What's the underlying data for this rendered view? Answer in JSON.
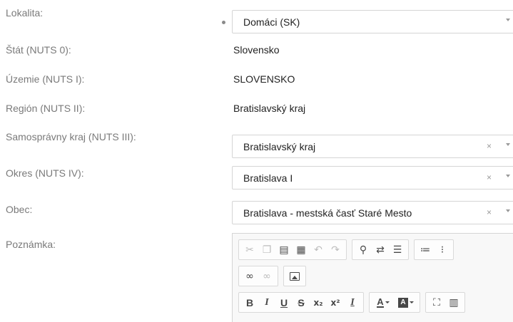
{
  "form": {
    "lokalita": {
      "label": "Lokalita:",
      "value": "Domáci (SK)"
    },
    "stat": {
      "label": "Štát (NUTS 0):",
      "value": "Slovensko"
    },
    "uzemie": {
      "label": "Územie (NUTS I):",
      "value": "SLOVENSKO"
    },
    "region": {
      "label": "Región (NUTS II):",
      "value": "Bratislavský kraj"
    },
    "kraj": {
      "label": "Samosprávny kraj (NUTS III):",
      "value": "Bratislavský kraj"
    },
    "okres": {
      "label": "Okres (NUTS IV):",
      "value": "Bratislava I"
    },
    "obec": {
      "label": "Obec:",
      "value": "Bratislava - mestská časť Staré Mesto"
    },
    "poznamka": {
      "label": "Poznámka:"
    }
  },
  "select_clear_glyph": "×",
  "editor": {
    "bold": "B",
    "italic": "I",
    "underline": "U",
    "strike": "S",
    "subscript": "x₂",
    "superscript": "x²",
    "remove_format": "I",
    "text_color": "A",
    "bg_color": "A",
    "icons": [
      "cut-icon",
      "copy-icon",
      "paste-icon",
      "paste-text-icon",
      "undo-icon",
      "redo-icon",
      "find-icon",
      "replace-icon",
      "select-all-icon",
      "numbered-list-icon",
      "bulleted-list-icon",
      "link-icon",
      "unlink-icon",
      "image-icon",
      "maximize-icon",
      "show-blocks-icon"
    ]
  },
  "colors": {
    "label": "#7a7a7a",
    "value": "#222222",
    "border": "#d5d5d5",
    "toolbar_bg": "#f8f8f8"
  }
}
